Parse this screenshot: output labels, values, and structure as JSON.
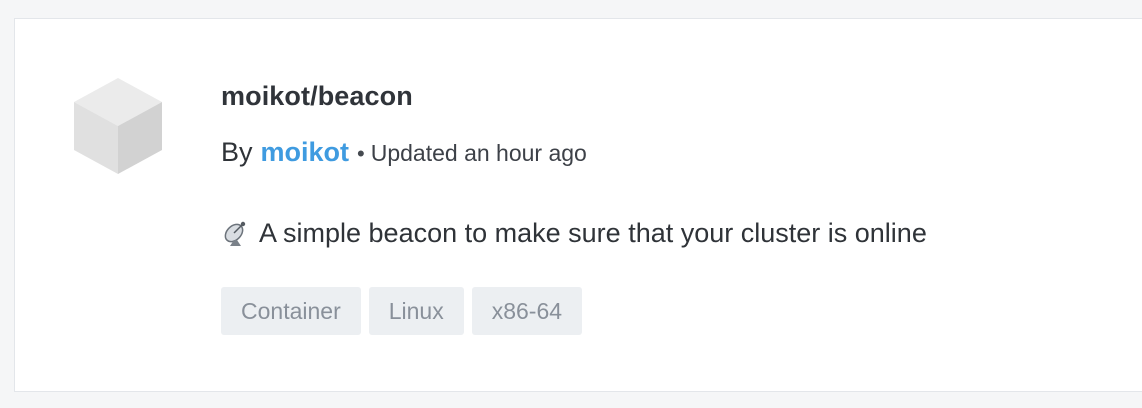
{
  "repo": {
    "name": "moikot/beacon",
    "by_label": "By",
    "author": "moikot",
    "separator": "•",
    "updated": "Updated an hour ago",
    "description_icon": "satellite-antenna-icon",
    "description": "A simple beacon to make sure that your cluster is online",
    "logo_icon": "cube-icon",
    "tags": [
      "Container",
      "Linux",
      "x86-64"
    ]
  },
  "colors": {
    "author_link": "#3f9be0",
    "tag_bg": "#eceff2",
    "tag_text": "#89909a"
  }
}
